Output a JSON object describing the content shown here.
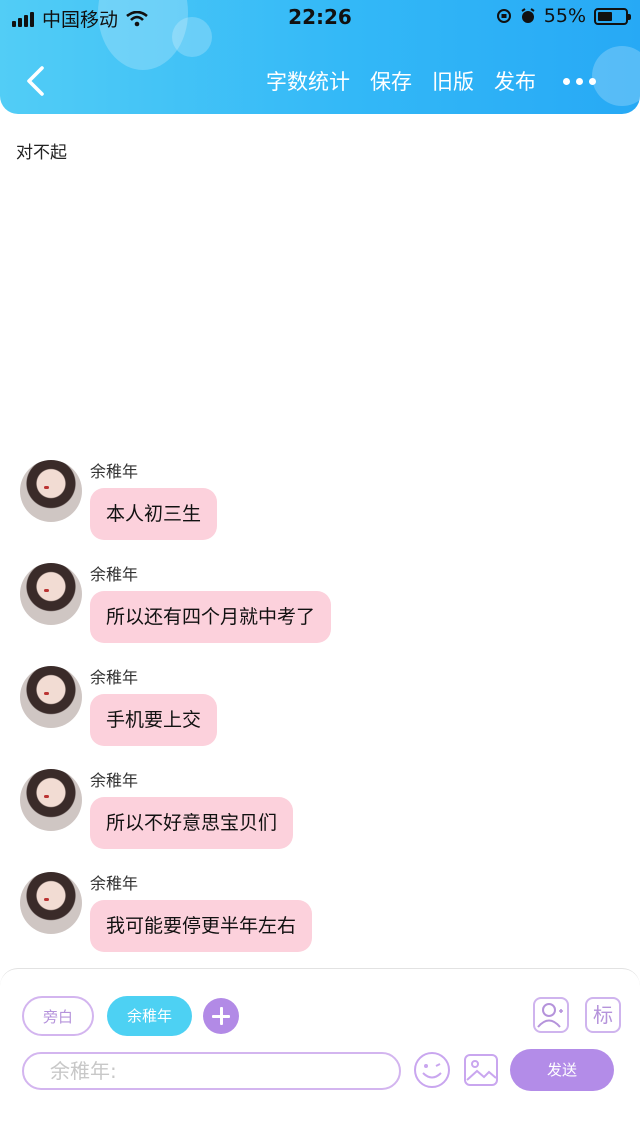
{
  "status_bar": {
    "carrier": "中国移动",
    "time": "22:26",
    "battery": "55%",
    "battery_level": 0.55
  },
  "nav": {
    "actions": [
      "字数统计",
      "保存",
      "旧版",
      "发布"
    ]
  },
  "document": {
    "title": "对不起"
  },
  "messages": [
    {
      "name": "余稚年",
      "text": "本人初三生"
    },
    {
      "name": "余稚年",
      "text": "所以还有四个月就中考了"
    },
    {
      "name": "余稚年",
      "text": "手机要上交"
    },
    {
      "name": "余稚年",
      "text": "所以不好意思宝贝们"
    },
    {
      "name": "余稚年",
      "text": "我可能要停更半年左右"
    }
  ],
  "composer": {
    "narrator_label": "旁白",
    "role_label": "余稚年",
    "mark_label": "标",
    "input_placeholder": "余稚年:",
    "send_label": "发送"
  },
  "colors": {
    "header_start": "#52cdf6",
    "header_end": "#27a9f5",
    "bubble": "#fcd1dc",
    "accent_purple": "#b38ce8",
    "role_chip": "#4dd1f3"
  }
}
